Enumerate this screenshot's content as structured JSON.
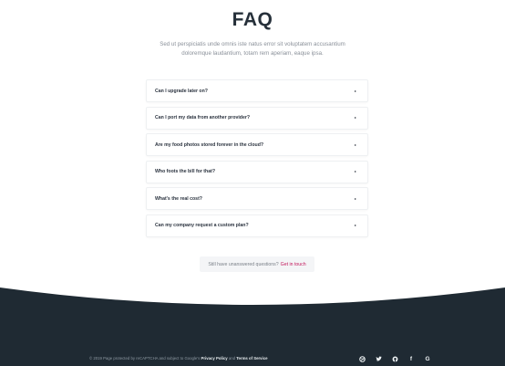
{
  "header": {
    "title": "FAQ",
    "subtitle": "Sed ut perspiciatis unde omnis iste natus error sit voluptatem accusantium doloremque laudantium, totam rem aperiam, eaque ipsa."
  },
  "faq": {
    "items": [
      {
        "question": "Can I upgrade later on?"
      },
      {
        "question": "Can I port my data from another provider?"
      },
      {
        "question": "Are my food photos stored forever in the cloud?"
      },
      {
        "question": "Who foots the bill for that?"
      },
      {
        "question": "What's the real cost?"
      },
      {
        "question": "Can my company request a custom plan?"
      }
    ]
  },
  "cta": {
    "text": "Still have unanswered questions?",
    "link": "Get in touch"
  },
  "footer": {
    "legal_prefix": "© 2019 Page protected by reCAPTCHA and subject to Google's",
    "privacy": "Privacy Policy",
    "and": "and",
    "terms": "Terms of Service",
    "socials": {
      "facebook": "f",
      "google": "G"
    },
    "colors": {
      "footer_bg": "#1f2a33",
      "accent": "#c2185b"
    }
  }
}
